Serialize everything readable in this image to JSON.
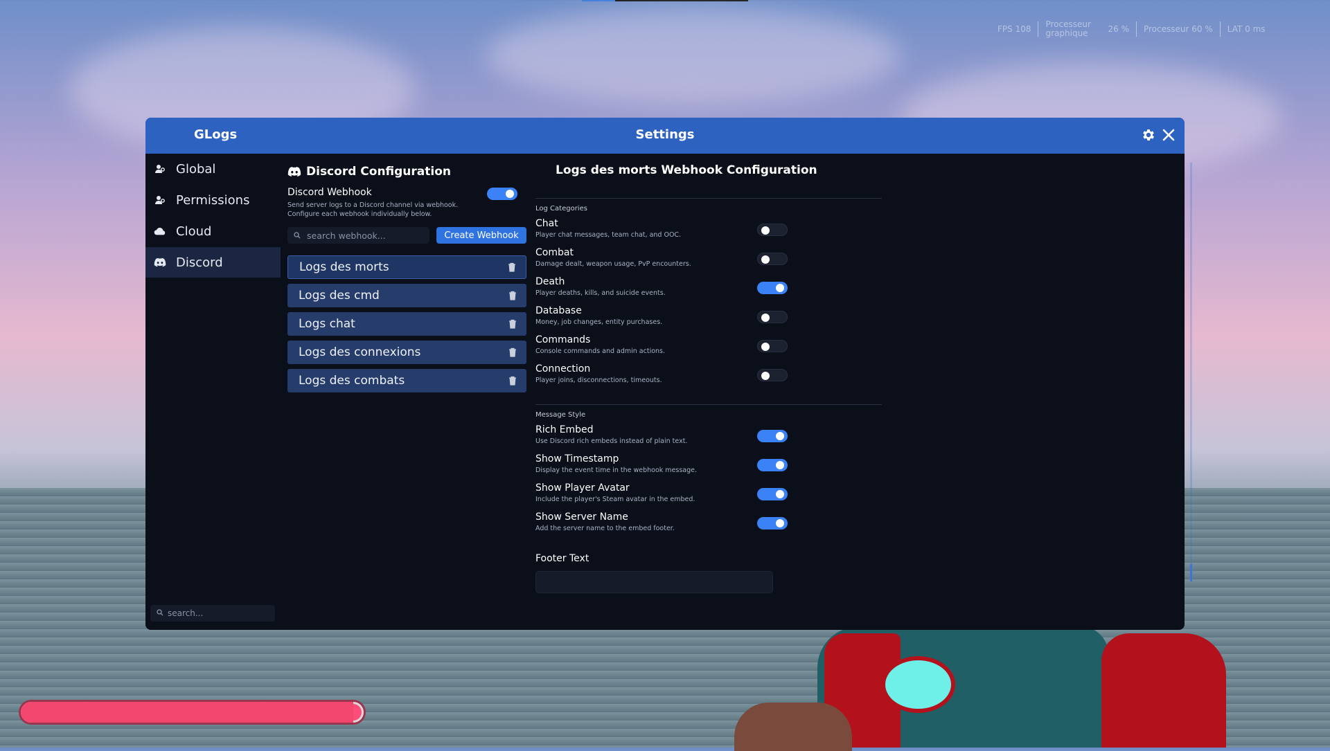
{
  "hud": {
    "fps_label": "FPS 108",
    "gpu_label": "Processeur graphique",
    "gpu_value": "26 %",
    "cpu_label": "Processeur 60 %",
    "lat_label": "LAT 0 ms",
    "health_fraction": 0.97
  },
  "window": {
    "app_name": "GLogs",
    "title": "Settings"
  },
  "sidebar": {
    "items": [
      {
        "label": "Global",
        "icon": "users-icon"
      },
      {
        "label": "Permissions",
        "icon": "users-icon"
      },
      {
        "label": "Cloud",
        "icon": "cloud-icon"
      },
      {
        "label": "Discord",
        "icon": "discord-icon",
        "active": true
      }
    ],
    "search_placeholder": "search..."
  },
  "discord": {
    "section_title": "Discord Configuration",
    "webhook_label": "Discord Webhook",
    "webhook_desc_1": "Send server logs to a Discord channel via webhook.",
    "webhook_desc_2": "Configure each webhook individually below.",
    "webhook_enabled": true,
    "search_placeholder": "search webhook...",
    "create_label": "Create Webhook",
    "webhooks": [
      {
        "label": "Logs des morts",
        "selected": true
      },
      {
        "label": "Logs des cmd"
      },
      {
        "label": "Logs chat"
      },
      {
        "label": "Logs des connexions"
      },
      {
        "label": "Logs des combats"
      }
    ]
  },
  "config": {
    "title": "Logs des morts Webhook Configuration",
    "categories_label": "Log Categories",
    "categories": [
      {
        "name": "Chat",
        "desc": "Player chat messages, team chat, and OOC.",
        "on": false
      },
      {
        "name": "Combat",
        "desc": "Damage dealt, weapon usage, PvP encounters.",
        "on": false
      },
      {
        "name": "Death",
        "desc": "Player deaths, kills, and suicide events.",
        "on": true
      },
      {
        "name": "Database",
        "desc": "Money, job changes, entity purchases.",
        "on": false
      },
      {
        "name": "Commands",
        "desc": "Console commands and admin actions.",
        "on": false
      },
      {
        "name": "Connection",
        "desc": "Player joins, disconnections, timeouts.",
        "on": false
      }
    ],
    "style_label": "Message Style",
    "styles": [
      {
        "name": "Rich Embed",
        "desc": "Use Discord rich embeds instead of plain text.",
        "on": true
      },
      {
        "name": "Show Timestamp",
        "desc": "Display the event time in the webhook message.",
        "on": true
      },
      {
        "name": "Show Player Avatar",
        "desc": "Include the player's Steam avatar in the embed.",
        "on": true
      },
      {
        "name": "Show Server Name",
        "desc": "Add the server name to the embed footer.",
        "on": true
      }
    ],
    "footer_label": "Footer Text",
    "footer_value": ""
  },
  "colors": {
    "accent": "#2e62c1",
    "toggle_on": "#3b82f6",
    "webhook_item": "#263d6c",
    "window_bg": "#0b0f1a"
  }
}
